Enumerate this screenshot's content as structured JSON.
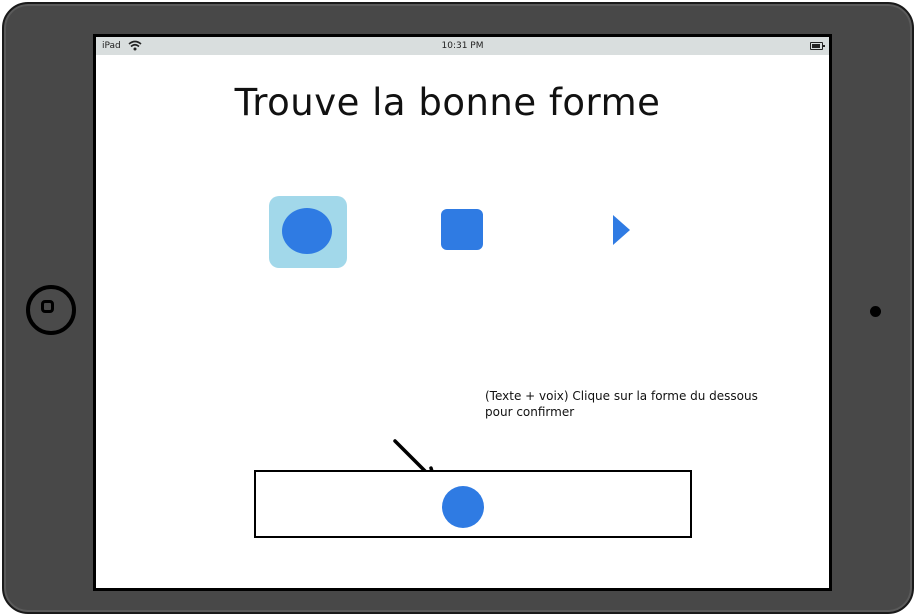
{
  "statusbar": {
    "carrier": "iPad",
    "time": "10:31 PM"
  },
  "title": "Trouve la bonne forme",
  "shapes": [
    {
      "name": "circle",
      "selected": true
    },
    {
      "name": "square",
      "selected": false
    },
    {
      "name": "triangle",
      "selected": false
    }
  ],
  "instruction": {
    "line1": "(Texte + voix) Clique sur la forme du dessous",
    "line2": "pour confirmer"
  },
  "colors": {
    "shape": "#2f7be3",
    "selection": "#a2d8ea",
    "device": "#484848"
  },
  "icons": [
    "wifi-icon",
    "battery-icon",
    "arrow-icon",
    "home-button-icon",
    "camera-icon"
  ]
}
